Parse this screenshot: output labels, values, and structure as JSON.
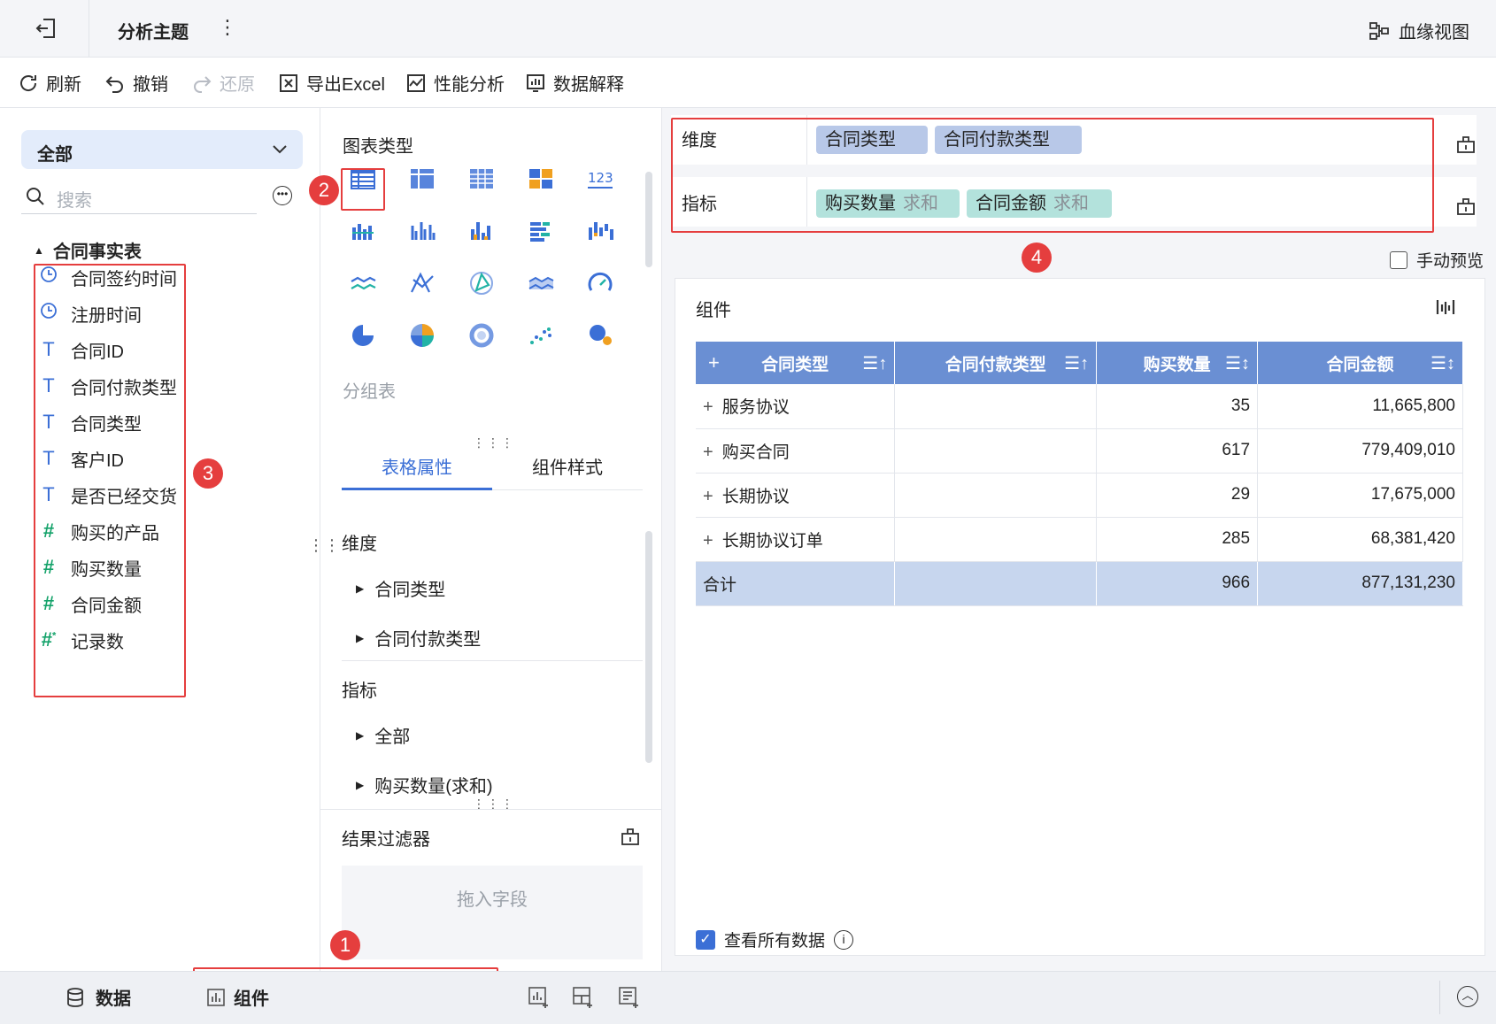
{
  "topbar": {
    "title": "分析主题",
    "lineage_label": "血缘视图"
  },
  "toolbar": {
    "refresh": "刷新",
    "undo": "撤销",
    "redo": "还原",
    "export": "导出Excel",
    "performance": "性能分析",
    "explain": "数据解释"
  },
  "left": {
    "scope_select": "全部",
    "search_placeholder": "搜索",
    "table_name": "合同事实表",
    "fields": [
      {
        "label": "合同签约时间",
        "type": "time"
      },
      {
        "label": "注册时间",
        "type": "time"
      },
      {
        "label": "合同ID",
        "type": "text"
      },
      {
        "label": "合同付款类型",
        "type": "text"
      },
      {
        "label": "合同类型",
        "type": "text"
      },
      {
        "label": "客户ID",
        "type": "text"
      },
      {
        "label": "是否已经交货",
        "type": "text"
      },
      {
        "label": "购买的产品",
        "type": "number"
      },
      {
        "label": "购买数量",
        "type": "number"
      },
      {
        "label": "合同金额",
        "type": "number"
      },
      {
        "label": "记录数",
        "type": "count"
      }
    ]
  },
  "middle": {
    "chart_types_title": "图表类型",
    "chart_type_selected": "分组表",
    "tabs": [
      "表格属性",
      "组件样式"
    ],
    "dimension_title": "维度",
    "dimension_items": [
      "合同类型",
      "合同付款类型"
    ],
    "metric_title": "指标",
    "metric_items": [
      "全部",
      "购买数量(求和)"
    ],
    "result_filter_title": "结果过滤器",
    "drop_placeholder": "拖入字段"
  },
  "right": {
    "dimension_label": "维度",
    "dimension_chips": [
      "合同类型",
      "合同付款类型"
    ],
    "metric_label": "指标",
    "metric_chips": [
      {
        "name": "购买数量",
        "agg": "求和"
      },
      {
        "name": "合同金额",
        "agg": "求和"
      }
    ],
    "manual_preview": "手动预览",
    "component_title": "组件",
    "table": {
      "headers": [
        "合同类型",
        "合同付款类型",
        "购买数量",
        "合同金额"
      ],
      "expand_symbol": "+",
      "rows": [
        {
          "type": "服务协议",
          "qty": "35",
          "amount": "11,665,800"
        },
        {
          "type": "购买合同",
          "qty": "617",
          "amount": "779,409,010"
        },
        {
          "type": "长期协议",
          "qty": "29",
          "amount": "17,675,000"
        },
        {
          "type": "长期协议订单",
          "qty": "285",
          "amount": "68,381,420"
        }
      ],
      "total": {
        "label": "合计",
        "qty": "966",
        "amount": "877,131,230"
      }
    },
    "view_all_data": "查看所有数据"
  },
  "bottom": {
    "data_tab": "数据",
    "component_tab": "组件"
  },
  "badges": [
    "1",
    "2",
    "3",
    "4"
  ],
  "colors": {
    "accent": "#3b6fd6",
    "highlight_red": "#e53e3e",
    "header_blue": "#6a8fd3",
    "total_row": "#c7d6ee",
    "dim_chip": "#b8c8e8",
    "measure_chip": "#b3e2dc",
    "number_icon": "#16a36b"
  }
}
